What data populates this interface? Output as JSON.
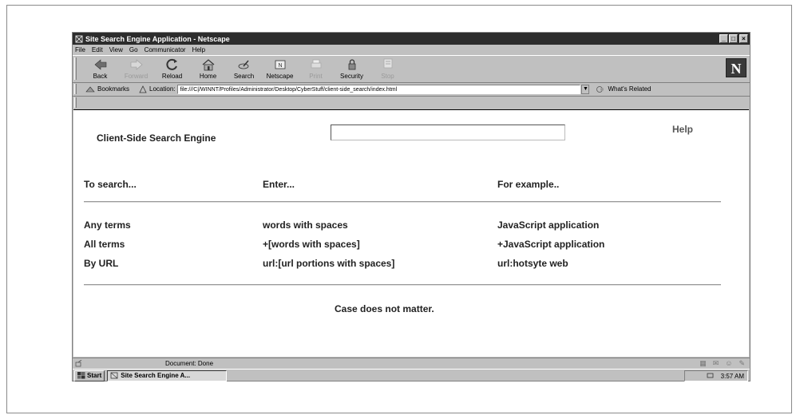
{
  "window": {
    "title": "Site Search Engine Application - Netscape",
    "controls": {
      "minimize": "_",
      "maximize": "□",
      "close": "×"
    }
  },
  "menu": [
    {
      "label": "File"
    },
    {
      "label": "Edit"
    },
    {
      "label": "View"
    },
    {
      "label": "Go"
    },
    {
      "label": "Communicator"
    },
    {
      "label": "Help"
    }
  ],
  "toolbar": {
    "buttons": [
      {
        "label": "Back",
        "icon": "back-arrow-icon",
        "enabled": true
      },
      {
        "label": "Forward",
        "icon": "forward-arrow-icon",
        "enabled": false
      },
      {
        "label": "Reload",
        "icon": "reload-icon",
        "enabled": true
      },
      {
        "label": "Home",
        "icon": "home-icon",
        "enabled": true
      },
      {
        "label": "Search",
        "icon": "search-icon",
        "enabled": true
      },
      {
        "label": "Netscape",
        "icon": "netscape-icon",
        "enabled": true
      },
      {
        "label": "Print",
        "icon": "print-icon",
        "enabled": false
      },
      {
        "label": "Security",
        "icon": "security-icon",
        "enabled": true
      },
      {
        "label": "Stop",
        "icon": "stop-icon",
        "enabled": false
      }
    ],
    "logo": "N"
  },
  "location_bar": {
    "bookmarks_label": "Bookmarks",
    "location_label": "Location:",
    "url": "file:///C|/WINNT/Profiles/Administrator/Desktop/CyberStuff/client-side_search/index.html",
    "related_label": "What's Related"
  },
  "page": {
    "heading": "Client-Side Search Engine",
    "search_value": "",
    "help_label": "Help",
    "columns": {
      "to_search": "To search...",
      "enter": "Enter...",
      "example": "For example.."
    },
    "rows": [
      {
        "to_search": "Any terms",
        "enter": "words with spaces",
        "example": "JavaScript application"
      },
      {
        "to_search": "All terms",
        "enter": "+[words with spaces]",
        "example": "+JavaScript application"
      },
      {
        "to_search": "By URL",
        "enter": "url:[url portions with spaces]",
        "example": "url:hotsyte web"
      }
    ],
    "footnote": "Case does not matter."
  },
  "status": {
    "text": "Document: Done"
  },
  "taskbar": {
    "start_label": "Start",
    "task_label": "Site Search Engine A...",
    "clock": "3:57 AM"
  },
  "colors": {
    "titlebar": "#2c2c2c",
    "chrome": "#c0c0c0",
    "content_bg": "#ffffff"
  }
}
